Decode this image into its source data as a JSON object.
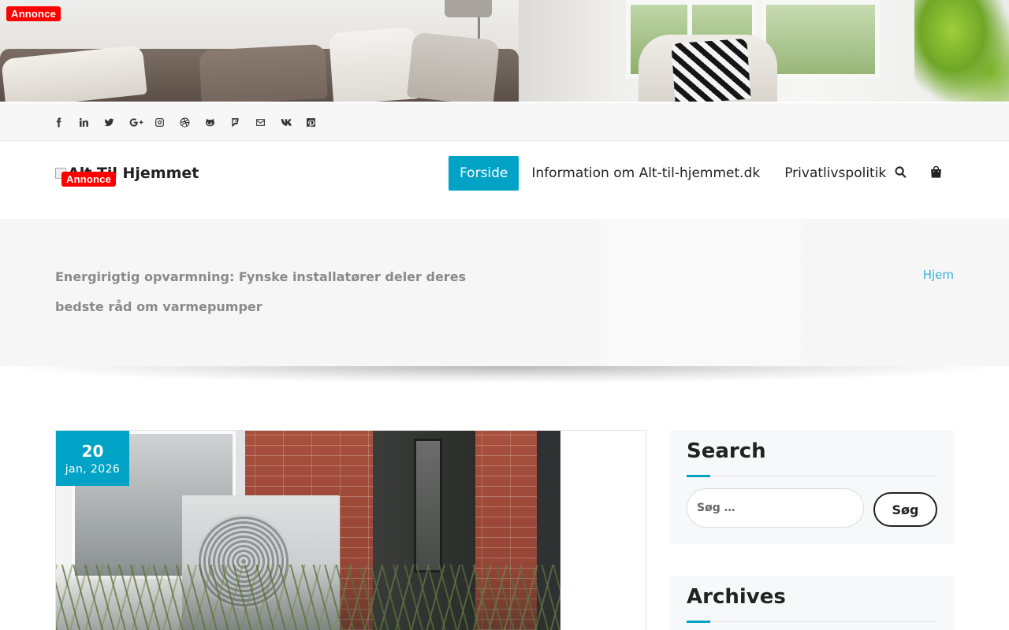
{
  "ads": {
    "top_badge": "Annonce",
    "logo_badge": "Annonce"
  },
  "social_icons": [
    "facebook-icon",
    "linkedin-icon",
    "twitter-icon",
    "google-plus-icon",
    "instagram-icon",
    "dribbble-icon",
    "github-icon",
    "foursquare-icon",
    "email-icon",
    "vk-icon",
    "pinterest-icon"
  ],
  "header": {
    "logo_alt": "Alt Til Hjemmet",
    "nav": [
      {
        "label": "Forside",
        "active": true
      },
      {
        "label": "Information om Alt-til-hjemmet.dk",
        "active": false
      },
      {
        "label": "Privatlivspolitik",
        "active": false
      }
    ],
    "icons": [
      "search-icon",
      "shopping-bag-icon"
    ]
  },
  "page": {
    "title": "Energirigtig opvarmning: Fynske installatører deler deres bedste råd om varmepumper",
    "breadcrumb": "Hjem"
  },
  "post": {
    "date_day": "20",
    "date_month": "jan, 2026"
  },
  "sidebar": {
    "search": {
      "title": "Search",
      "placeholder": "Søg …",
      "button": "Søg"
    },
    "archives": {
      "title": "Archives"
    }
  },
  "colors": {
    "accent": "#00a3c6",
    "ad_badge": "#ff0000",
    "breadcrumb": "#36b3d3"
  }
}
